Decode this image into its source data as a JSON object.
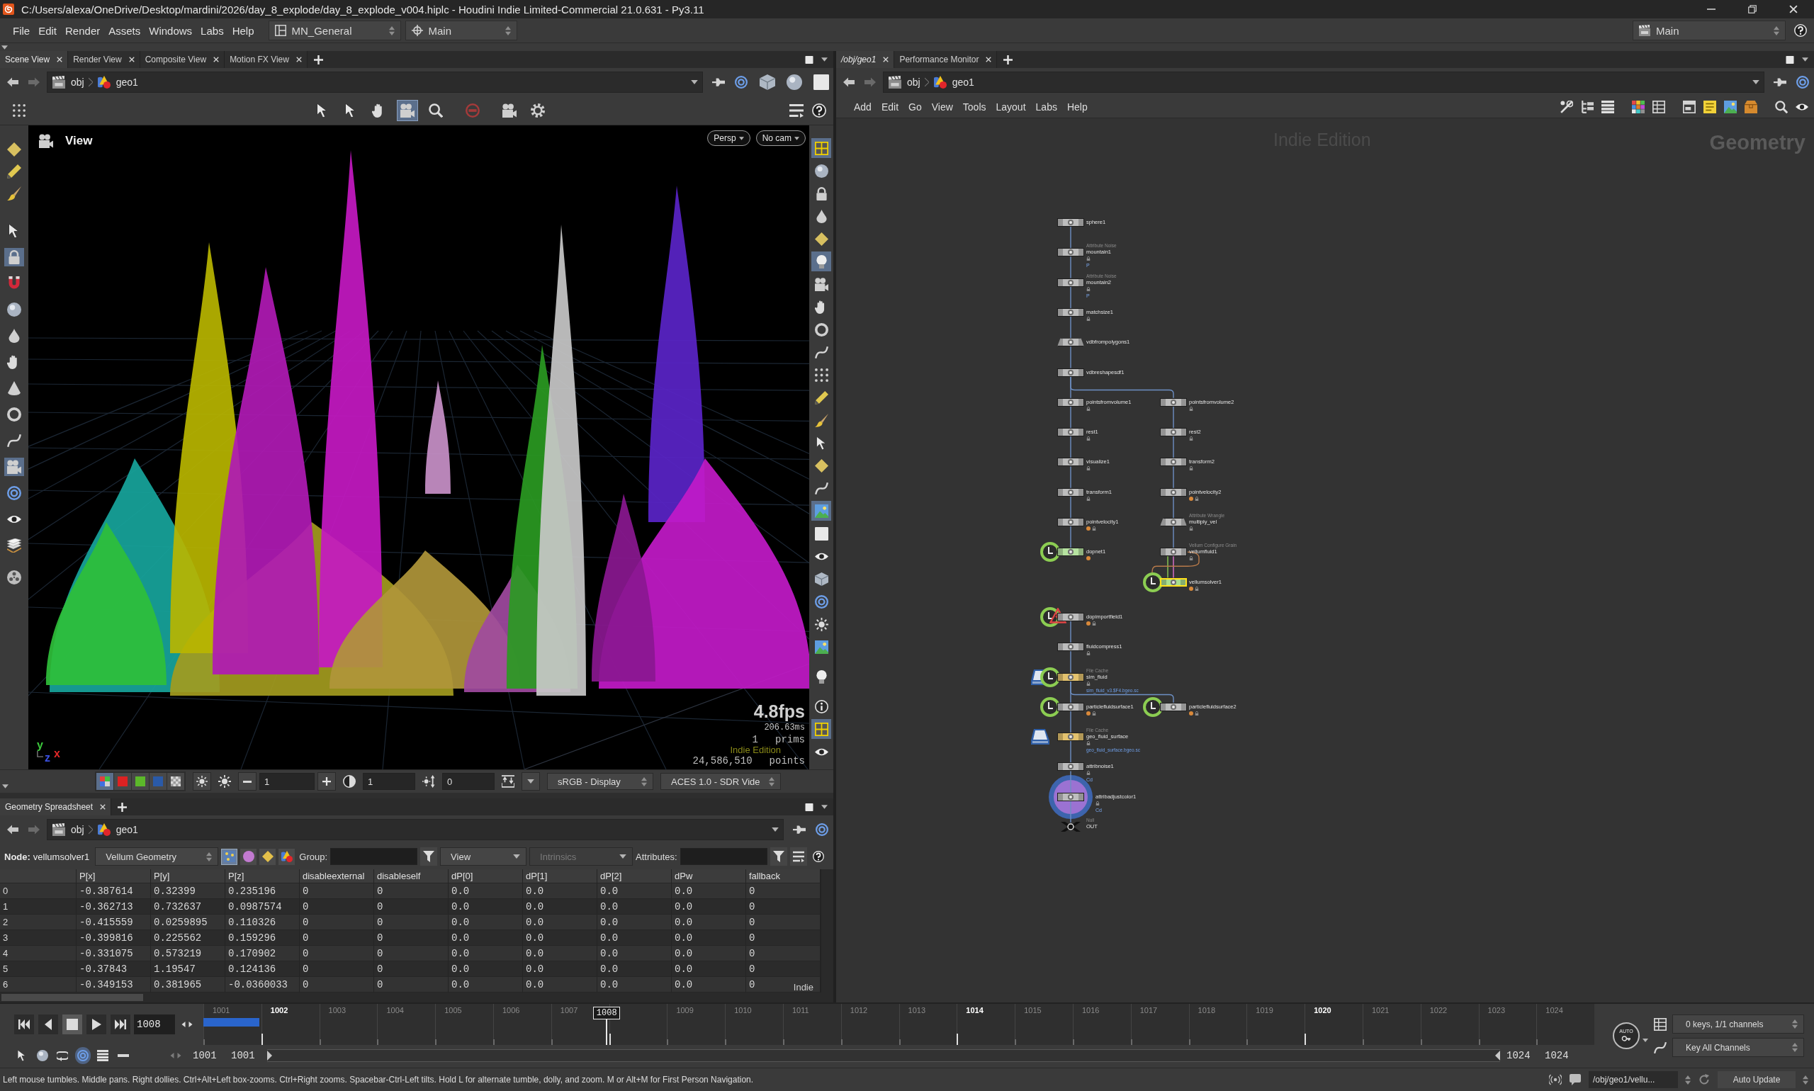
{
  "window": {
    "title": "C:/Users/alexa/OneDrive/Desktop/mardini/2026/day_8_explode/day_8_explode_v004.hiplc - Houdini Indie Limited-Commercial 21.0.631 - Py3.11"
  },
  "menu_bar": {
    "menus": [
      "File",
      "Edit",
      "Render",
      "Assets",
      "Windows",
      "Labs",
      "Help"
    ],
    "desktop": "MN_General",
    "context": "Main",
    "right_context": "Main"
  },
  "scene_pane": {
    "tabs": [
      {
        "label": "Scene View",
        "selected": true
      },
      {
        "label": "Render View",
        "selected": false
      },
      {
        "label": "Composite View",
        "selected": false
      },
      {
        "label": "Motion FX View",
        "selected": false
      }
    ],
    "path": [
      "obj",
      "geo1"
    ],
    "view_tools": [
      {
        "selected": false
      },
      {
        "selected": false
      },
      {
        "selected": false
      },
      {
        "selected": true
      },
      {
        "selected": false
      },
      {
        "selected": false
      },
      {
        "selected": false
      },
      {
        "selected": false
      }
    ],
    "left_tools": [
      {
        "selected": false
      },
      {
        "selected": false
      },
      {
        "selected": false
      },
      {
        "selected": false
      },
      {
        "selected": true
      },
      {
        "selected": false
      },
      {
        "selected": false
      },
      {
        "selected": false
      },
      {
        "selected": false
      },
      {
        "selected": false
      },
      {
        "selected": false
      },
      {
        "selected": false
      },
      {
        "selected": true
      },
      {
        "selected": false
      },
      {
        "selected": false
      },
      {
        "selected": false
      },
      {
        "selected": false
      }
    ],
    "right_tools": [
      {
        "selected": true
      },
      {
        "selected": false
      },
      {
        "selected": false
      },
      {
        "selected": false
      },
      {
        "selected": false
      },
      {
        "selected": true
      },
      {
        "selected": false
      },
      {
        "selected": false
      },
      {
        "selected": false
      },
      {
        "selected": false
      },
      {
        "selected": false
      },
      {
        "selected": false
      },
      {
        "selected": false
      },
      {
        "selected": false
      },
      {
        "selected": false
      },
      {
        "selected": false
      },
      {
        "selected": true
      },
      {
        "selected": false
      },
      {
        "selected": false
      },
      {
        "selected": false
      },
      {
        "selected": false
      },
      {
        "selected": false
      },
      {
        "selected": false
      },
      {
        "selected": false
      },
      {
        "selected": false
      },
      {
        "selected": true
      },
      {
        "selected": false
      }
    ],
    "viewport": {
      "title": "View",
      "menus": [
        "Persp",
        "No cam"
      ],
      "fps": "4.8fps",
      "frame_time": "206.63ms",
      "stats": [
        {
          "value": "1",
          "label": "prims"
        },
        {
          "value": "24,586,510",
          "label": "points"
        }
      ],
      "edition": "Indie Edition",
      "axes": [
        {
          "label": "y",
          "color": "#3cc83c"
        },
        {
          "label": "z",
          "color": "#3a50e0"
        },
        {
          "label": "x",
          "color": "#e02828"
        }
      ]
    },
    "display_bar": {
      "channels": [
        {
          "selected": true
        },
        {
          "selected": false
        },
        {
          "selected": false
        },
        {
          "selected": false
        },
        {
          "selected": false
        }
      ],
      "exposure": "1",
      "gamma": "1",
      "frame": "0",
      "display": "sRGB - Display",
      "view": "ACES 1.0 - SDR Vide"
    }
  },
  "spreadsheet": {
    "tabs": [
      {
        "label": "Geometry Spreadsheet",
        "selected": true
      }
    ],
    "path": [
      "obj",
      "geo1"
    ],
    "node_label": "Node:",
    "node": "vellumsolver1",
    "source": "Vellum Geometry",
    "modes": [
      {
        "selected": true
      },
      {
        "selected": false
      },
      {
        "selected": false
      },
      {
        "selected": false
      }
    ],
    "group_label": "Group:",
    "view": "View",
    "intrinsics": {
      "label": "Intrinsics",
      "disabled": true
    },
    "attributes_label": "Attributes:",
    "columns": [
      "P[x]",
      "P[y]",
      "P[z]",
      "disableexternal",
      "disableself",
      "dP[0]",
      "dP[1]",
      "dP[2]",
      "dPw",
      "fallback"
    ],
    "rows": [
      {
        "index": "0",
        "cells": [
          "-0.387614",
          "0.32399",
          "0.235196",
          "0",
          "0",
          "0.0",
          "0.0",
          "0.0",
          "0.0",
          "0"
        ]
      },
      {
        "index": "1",
        "cells": [
          "-0.362713",
          "0.732637",
          "0.0987574",
          "0",
          "0",
          "0.0",
          "0.0",
          "0.0",
          "0.0",
          "0"
        ]
      },
      {
        "index": "2",
        "cells": [
          "-0.415559",
          "0.0259895",
          "0.110326",
          "0",
          "0",
          "0.0",
          "0.0",
          "0.0",
          "0.0",
          "0"
        ]
      },
      {
        "index": "3",
        "cells": [
          "-0.399816",
          "0.225562",
          "0.159296",
          "0",
          "0",
          "0.0",
          "0.0",
          "0.0",
          "0.0",
          "0"
        ]
      },
      {
        "index": "4",
        "cells": [
          "-0.331075",
          "0.573219",
          "0.170902",
          "0",
          "0",
          "0.0",
          "0.0",
          "0.0",
          "0.0",
          "0"
        ]
      },
      {
        "index": "5",
        "cells": [
          "-0.37843",
          "1.19547",
          "0.124136",
          "0",
          "0",
          "0.0",
          "0.0",
          "0.0",
          "0.0",
          "0"
        ]
      },
      {
        "index": "6",
        "cells": [
          "-0.349153",
          "0.381965",
          "-0.0360033",
          "0",
          "0",
          "0.0",
          "0.0",
          "0.0",
          "0.0",
          "0"
        ]
      }
    ],
    "edition": "Indie"
  },
  "network_pane": {
    "tabs": [
      {
        "label": "/obj/geo1",
        "selected": true
      },
      {
        "label": "Performance Monitor",
        "selected": false
      }
    ],
    "path": [
      "obj",
      "geo1"
    ],
    "menus": [
      "Add",
      "Edit",
      "Go",
      "View",
      "Tools",
      "Layout",
      "Labs",
      "Help"
    ],
    "edition": "Indie Edition",
    "context_label": "Geometry",
    "nodes": [
      {
        "name": "sphere1",
        "kind": "box",
        "color": "#bdbdbd",
        "selected": false,
        "locked": false,
        "badge": false,
        "time_dependent": false,
        "error": false,
        "cached": false,
        "display": false
      },
      {
        "type_label": "Attribute Noise",
        "name": "mountain1",
        "param": "P",
        "kind": "box",
        "color": "#bdbdbd",
        "selected": false,
        "locked": true,
        "badge": false,
        "time_dependent": false,
        "error": false,
        "cached": false,
        "display": false
      },
      {
        "type_label": "Attribute Noise",
        "name": "mountain2",
        "param": "P",
        "kind": "box",
        "color": "#bdbdbd",
        "selected": false,
        "locked": true,
        "badge": false,
        "time_dependent": false,
        "error": false,
        "cached": false,
        "display": false
      },
      {
        "name": "matchsize1",
        "kind": "box",
        "color": "#bdbdbd",
        "selected": false,
        "locked": true,
        "badge": false,
        "time_dependent": false,
        "error": false,
        "cached": false,
        "display": false
      },
      {
        "name": "vdbfrompolygons1",
        "kind": "trapezoid",
        "color": "#bdbdbd",
        "selected": false,
        "locked": false,
        "badge": false,
        "time_dependent": false,
        "error": false,
        "cached": false,
        "display": false
      },
      {
        "name": "vdbreshapesdf1",
        "kind": "box",
        "color": "#bdbdbd",
        "selected": false,
        "locked": false,
        "badge": false,
        "time_dependent": false,
        "error": false,
        "cached": false,
        "display": false
      },
      {
        "name": "pointsfromvolume1",
        "kind": "box",
        "color": "#bdbdbd",
        "selected": false,
        "locked": true,
        "badge": false,
        "time_dependent": false,
        "error": false,
        "cached": false,
        "display": false
      },
      {
        "name": "rest1",
        "kind": "box",
        "color": "#bdbdbd",
        "selected": false,
        "locked": true,
        "badge": false,
        "time_dependent": false,
        "error": false,
        "cached": false,
        "display": false
      },
      {
        "name": "visualize1",
        "kind": "box",
        "color": "#bdbdbd",
        "selected": false,
        "locked": true,
        "badge": false,
        "time_dependent": false,
        "error": false,
        "cached": false,
        "display": false
      },
      {
        "name": "transform1",
        "kind": "box",
        "color": "#bdbdbd",
        "selected": false,
        "locked": true,
        "badge": false,
        "time_dependent": false,
        "error": false,
        "cached": false,
        "display": false
      },
      {
        "name": "pointvelocity1",
        "kind": "box",
        "color": "#bdbdbd",
        "selected": false,
        "locked": true,
        "badge": true,
        "time_dependent": false,
        "error": false,
        "cached": false,
        "display": false
      },
      {
        "name": "dopnet1",
        "kind": "box",
        "color": "#b6e3a0",
        "selected": false,
        "locked": false,
        "badge": true,
        "time_dependent": true,
        "error": false,
        "cached": false,
        "display": false
      },
      {
        "name": "dopimportfield1",
        "kind": "box",
        "color": "#bdbdbd",
        "selected": false,
        "locked": true,
        "badge": true,
        "time_dependent": true,
        "error": true,
        "cached": false,
        "display": false
      },
      {
        "name": "fluidcompress1",
        "kind": "box",
        "color": "#bdbdbd",
        "selected": false,
        "locked": true,
        "badge": false,
        "time_dependent": false,
        "error": false,
        "cached": false,
        "display": false
      },
      {
        "type_label": "File Cache",
        "name": "sim_fluid",
        "file": "sim_fluid_v3.$F4.bgeo.sc",
        "kind": "box",
        "color": "#e3c26e",
        "selected": false,
        "locked": true,
        "badge": false,
        "time_dependent": true,
        "error": false,
        "cached": true,
        "display": false
      },
      {
        "name": "particlefluidsurface1",
        "kind": "box",
        "color": "#bdbdbd",
        "selected": false,
        "locked": true,
        "badge": true,
        "time_dependent": true,
        "error": false,
        "cached": false,
        "display": false
      },
      {
        "type_label": "File Cache",
        "name": "geo_fluid_surface",
        "file": "geo_fluid_surface.bgeo.sc",
        "kind": "box",
        "color": "#e3c26e",
        "selected": false,
        "locked": true,
        "badge": false,
        "time_dependent": false,
        "error": false,
        "cached": true,
        "display": false
      },
      {
        "name": "attribnoise1",
        "param": "Cd",
        "kind": "box",
        "color": "#bdbdbd",
        "selected": false,
        "locked": true,
        "badge": false,
        "time_dependent": false,
        "error": false,
        "cached": false,
        "display": false
      },
      {
        "name": "attribadjustcolor1",
        "param": "Cd",
        "kind": "box",
        "color": "#bdbdbd",
        "selected": false,
        "locked": true,
        "badge": false,
        "time_dependent": false,
        "error": false,
        "cached": false,
        "display": true
      },
      {
        "type_label": "Null",
        "name": "OUT",
        "kind": "null",
        "color": "#111111",
        "selected": false,
        "locked": false,
        "badge": false,
        "time_dependent": false,
        "error": false,
        "cached": false,
        "display": false
      },
      {
        "name": "pointsfromvolume2",
        "kind": "box",
        "color": "#bdbdbd",
        "selected": false,
        "locked": true,
        "badge": false,
        "time_dependent": false,
        "error": false,
        "cached": false,
        "display": false
      },
      {
        "name": "rest2",
        "kind": "box",
        "color": "#bdbdbd",
        "selected": false,
        "locked": true,
        "badge": false,
        "time_dependent": false,
        "error": false,
        "cached": false,
        "display": false
      },
      {
        "name": "transform2",
        "kind": "box",
        "color": "#bdbdbd",
        "selected": false,
        "locked": true,
        "badge": false,
        "time_dependent": false,
        "error": false,
        "cached": false,
        "display": false
      },
      {
        "name": "pointvelocity2",
        "kind": "box",
        "color": "#bdbdbd",
        "selected": false,
        "locked": true,
        "badge": true,
        "time_dependent": false,
        "error": false,
        "cached": false,
        "display": false
      },
      {
        "type_label": "Attribute Wrangle",
        "name": "multiply_vel",
        "kind": "trapezoid",
        "color": "#bdbdbd",
        "selected": false,
        "locked": true,
        "badge": false,
        "time_dependent": false,
        "error": false,
        "cached": false,
        "display": false
      },
      {
        "type_label": "Vellum Configure Grain",
        "name": "vellumfluid1",
        "kind": "box",
        "color": "#bdbdbd",
        "selected": false,
        "locked": true,
        "badge": false,
        "time_dependent": false,
        "error": false,
        "cached": false,
        "display": false
      },
      {
        "name": "vellumsolver1",
        "kind": "box",
        "color": "#a9de8f",
        "selected": true,
        "locked": true,
        "badge": true,
        "time_dependent": true,
        "error": false,
        "cached": false,
        "display": false
      },
      {
        "name": "particlefluidsurface2",
        "kind": "box",
        "color": "#bdbdbd",
        "selected": false,
        "locked": true,
        "badge": true,
        "time_dependent": true,
        "error": false,
        "cached": false,
        "display": false
      }
    ]
  },
  "timeline": {
    "transport": [
      {
        "selected": false
      },
      {
        "selected": false
      },
      {
        "selected": true
      },
      {
        "selected": false
      },
      {
        "selected": false
      }
    ],
    "frame": "1008",
    "ticks": [
      {
        "label": "1001",
        "emphasized": false
      },
      {
        "label": "1002",
        "emphasized": true
      },
      {
        "label": "1003",
        "emphasized": false
      },
      {
        "label": "1004",
        "emphasized": false
      },
      {
        "label": "1005",
        "emphasized": false
      },
      {
        "label": "1006",
        "emphasized": false
      },
      {
        "label": "1007",
        "emphasized": false
      },
      {
        "emphasized": true
      },
      {
        "label": "1009",
        "emphasized": false
      },
      {
        "label": "1010",
        "emphasized": false
      },
      {
        "label": "1011",
        "emphasized": false
      },
      {
        "label": "1012",
        "emphasized": false
      },
      {
        "label": "1013",
        "emphasized": false
      },
      {
        "label": "1014",
        "emphasized": true
      },
      {
        "label": "1015",
        "emphasized": false
      },
      {
        "label": "1016",
        "emphasized": false
      },
      {
        "label": "1017",
        "emphasized": false
      },
      {
        "label": "1018",
        "emphasized": false
      },
      {
        "label": "1019",
        "emphasized": false
      },
      {
        "label": "1020",
        "emphasized": true
      },
      {
        "label": "1021",
        "emphasized": false
      },
      {
        "label": "1022",
        "emphasized": false
      },
      {
        "label": "1023",
        "emphasized": false
      },
      {
        "label": "1024",
        "emphasized": false
      }
    ],
    "playhead": {
      "label": "1008",
      "level": 0.29
    },
    "cache_bar": {
      "level": 0.04
    },
    "range_tools": [
      {
        "selected": false
      },
      {
        "selected": false
      },
      {
        "selected": false
      },
      {
        "selected": true
      },
      {
        "selected": false
      },
      {
        "selected": false
      }
    ],
    "range_start": "1001",
    "playback_start": "1001",
    "playback_end": "1024",
    "range_end": "1024",
    "auto_key": "AUTO",
    "keys": "0 keys, 1/1 channels",
    "key_menu": "Key All Channels"
  },
  "status_bar": {
    "message": "Left mouse tumbles. Middle pans. Right dollies. Ctrl+Alt+Left box-zooms. Ctrl+Right zooms. Spacebar-Ctrl-Left tilts. Hold L for alternate tumble, dolly, and zoom. M or Alt+M for First Person Navigation.",
    "node_path": "/obj/geo1/vellu...",
    "update_mode": "Auto Update"
  }
}
